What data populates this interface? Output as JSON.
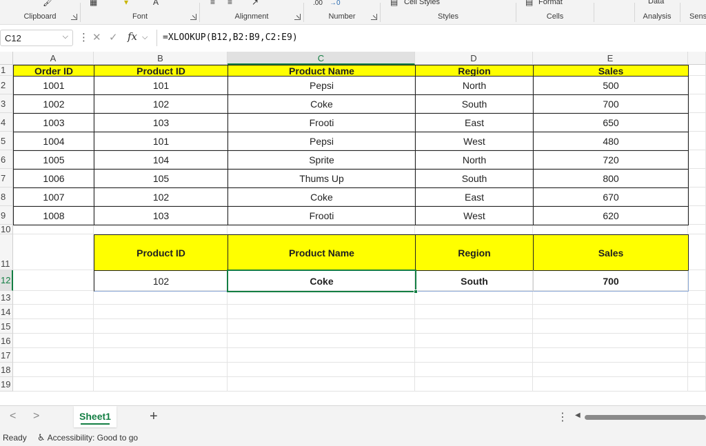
{
  "ribbon": {
    "groups": [
      {
        "label": "Clipboard",
        "launcher": true
      },
      {
        "label": "Font",
        "launcher": true
      },
      {
        "label": "Alignment",
        "launcher": true
      },
      {
        "label": "Number",
        "launcher": true
      },
      {
        "label": "Styles",
        "launcher": false
      },
      {
        "label": "Cells",
        "launcher": false
      },
      {
        "label": "Analysis",
        "launcher": false
      },
      {
        "label": "Sensi",
        "launcher": false
      }
    ],
    "cell_styles_label": "Cell Styles",
    "format_label": "Format",
    "number_decimal_text": ".00",
    "number_arrow_text": "→0",
    "data_label": "Data"
  },
  "formula_bar": {
    "name_box": "C12",
    "fx_label": "fx",
    "formula": "=XLOOKUP(B12,B2:B9,C2:E9)"
  },
  "sheet": {
    "columns": [
      "A",
      "B",
      "C",
      "D",
      "E"
    ],
    "active_column": "C",
    "active_row": "12",
    "rows": [
      "1",
      "2",
      "3",
      "4",
      "5",
      "6",
      "7",
      "8",
      "9",
      "10",
      "11",
      "12",
      "13",
      "14",
      "15",
      "16",
      "17",
      "18",
      "19"
    ],
    "header_row": [
      "Order ID",
      "Product ID",
      "Product Name",
      "Region",
      "Sales"
    ],
    "data_rows": [
      [
        "1001",
        "101",
        "Pepsi",
        "North",
        "500"
      ],
      [
        "1002",
        "102",
        "Coke",
        "South",
        "700"
      ],
      [
        "1003",
        "103",
        "Frooti",
        "East",
        "650"
      ],
      [
        "1004",
        "101",
        "Pepsi",
        "West",
        "480"
      ],
      [
        "1005",
        "104",
        "Sprite",
        "North",
        "720"
      ],
      [
        "1006",
        "105",
        "Thums Up",
        "South",
        "800"
      ],
      [
        "1007",
        "102",
        "Coke",
        "East",
        "670"
      ],
      [
        "1008",
        "103",
        "Frooti",
        "West",
        "620"
      ]
    ],
    "lookup_header": [
      "Product ID",
      "Product Name",
      "Region",
      "Sales"
    ],
    "lookup_result": [
      "102",
      "Coke",
      "South",
      "700"
    ]
  },
  "tabs": {
    "sheet_name": "Sheet1",
    "add_label": "+",
    "prev_label": "<",
    "next_label": ">"
  },
  "status": {
    "ready": "Ready",
    "accessibility": "Accessibility: Good to go"
  },
  "colors": {
    "header_fill": "#ffff00",
    "accent_green": "#137e43"
  }
}
